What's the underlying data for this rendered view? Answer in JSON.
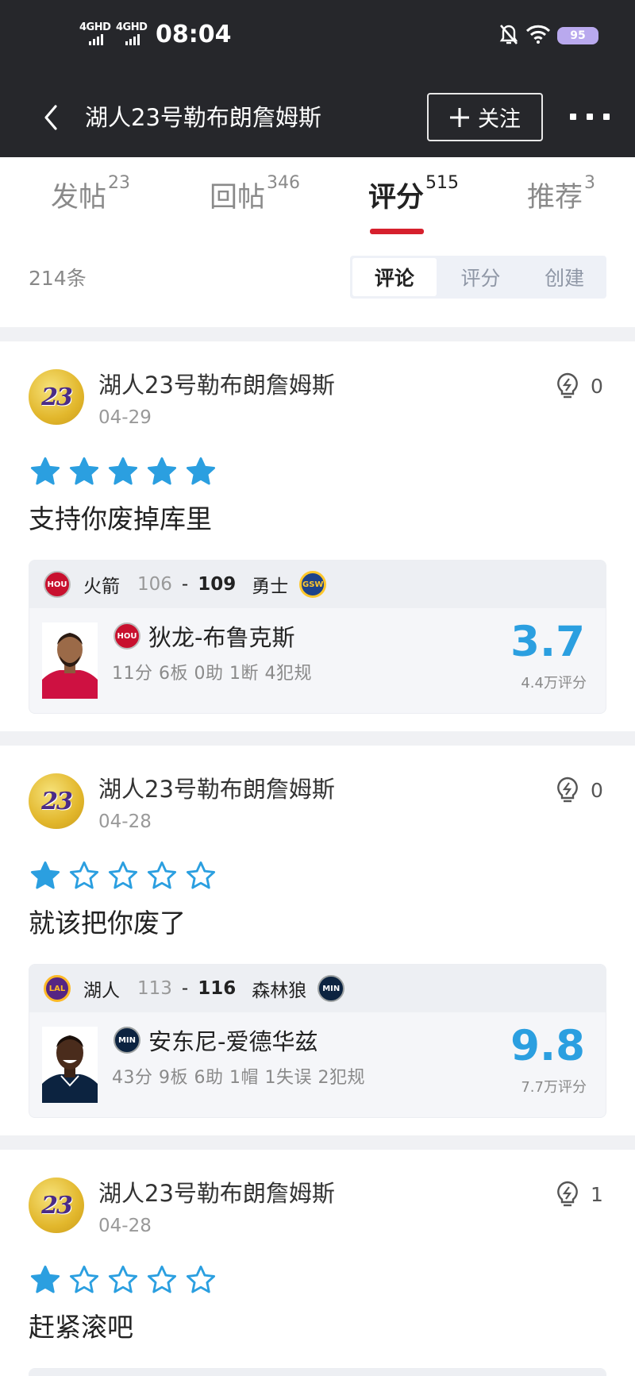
{
  "status_bar": {
    "net1": "4GHD",
    "net2": "4GHD",
    "time": "08:04",
    "battery": "95",
    "icons": [
      "mute-bell-icon",
      "wifi-icon",
      "battery-icon"
    ]
  },
  "nav": {
    "back_icon": "back-arrow-icon",
    "title": "湖人23号勒布朗詹姆斯",
    "follow_label": "关注",
    "more_icon": "more-icon"
  },
  "tabs": [
    {
      "label": "发帖",
      "count": "23"
    },
    {
      "label": "回帖",
      "count": "346"
    },
    {
      "label": "评分",
      "count": "515",
      "active": true
    },
    {
      "label": "推荐",
      "count": "3"
    }
  ],
  "filter": {
    "count": "214条",
    "segments": [
      "评论",
      "评分",
      "创建"
    ],
    "selected": "评论"
  },
  "colors": {
    "accent_red": "#d6202d",
    "score_blue": "#2b9fe0",
    "header_bg": "#26272b"
  },
  "posts": [
    {
      "avatar_text": "23",
      "author": "湖人23号勒布朗詹姆斯",
      "date": "04-29",
      "likes": "0",
      "rating": 5,
      "text": "支持你废掉库里",
      "match": {
        "team1": "火箭",
        "score1": "106",
        "score2": "109",
        "team2": "勇士",
        "logo1": "HOU",
        "logo2": "GSW"
      },
      "player": {
        "name": "狄龙-布鲁克斯",
        "team_logo": "HOU",
        "stats": "11分 6板 0助 1断 4犯规",
        "score": "3.7",
        "votes": "4.4万评分"
      }
    },
    {
      "avatar_text": "23",
      "author": "湖人23号勒布朗詹姆斯",
      "date": "04-28",
      "likes": "0",
      "rating": 1,
      "text": "就该把你废了",
      "match": {
        "team1": "湖人",
        "score1": "113",
        "score2": "116",
        "team2": "森林狼",
        "logo1": "LAL",
        "logo2": "MIN"
      },
      "player": {
        "name": "安东尼-爱德华兹",
        "team_logo": "MIN",
        "stats": "43分 9板 6助 1帽 1失误 2犯规",
        "score": "9.8",
        "votes": "7.7万评分"
      }
    },
    {
      "avatar_text": "23",
      "author": "湖人23号勒布朗詹姆斯",
      "date": "04-28",
      "likes": "1",
      "rating": 1,
      "text": "赶紧滚吧"
    }
  ]
}
